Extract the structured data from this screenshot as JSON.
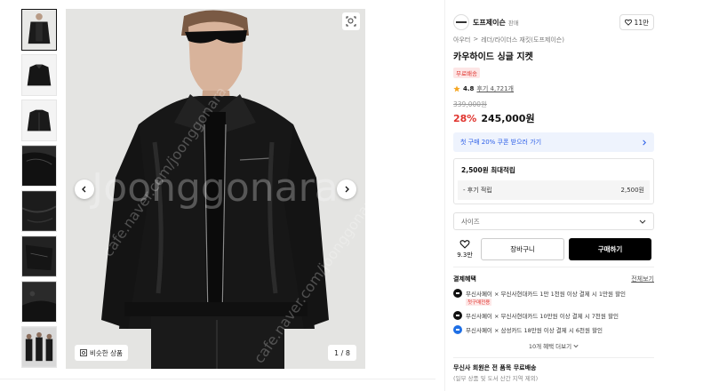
{
  "gallery": {
    "thumbnail_count": 8,
    "counter": "1 / 8",
    "similar_label": "비슷한 상품"
  },
  "product": {
    "brand": {
      "name": "도프제이슨",
      "subtitle": "판매"
    },
    "like_count": "11만",
    "breadcrumb": [
      "아우터",
      "레더/라이더스 재킷(도프제이슨)"
    ],
    "title": "카우하이드 싱글 지켓",
    "badge": "무료배송",
    "rating": "4.8",
    "reviews": "후기 4,721개",
    "original_price": "339,000원",
    "discount": "28%",
    "price": "245,000원",
    "coupon_text": "첫 구매 20% 쿠폰 받으러 가기",
    "points": {
      "title": "2,500원 최대적립",
      "label": "- 후기 적립",
      "value": "2,500원"
    },
    "size_placeholder": "사이즈",
    "heart_count": "9.3만",
    "cart_label": "장바구니",
    "buy_label": "구매하기"
  },
  "benefits": {
    "title": "결제혜택",
    "more_label": "전체보기",
    "cards": [
      {
        "text": "무신사페이 × 무신사현대카드 1만 1천원 이상 결제 시 1만원 할인",
        "tag": "첫구매전용",
        "color": "#111111"
      },
      {
        "text": "무신사페이 × 무신사현대카드 10만원 이상 결제 시 7천원 할인",
        "tag": "",
        "color": "#111111"
      },
      {
        "text": "무신사페이 × 삼성카드 18만원 이상 결제 시 6천원 할인",
        "tag": "",
        "color": "#1f6fe5"
      }
    ],
    "expand_label": "10개 혜택 더보기"
  },
  "shipping": {
    "title": "무신사 회원은 전 품목 무료배송",
    "subtitle": "(일부 상품 및 도서 산간 지역 제외)"
  },
  "watermarks": [
    "Joonggonara",
    "cafe.naver.com/joonggonara"
  ]
}
